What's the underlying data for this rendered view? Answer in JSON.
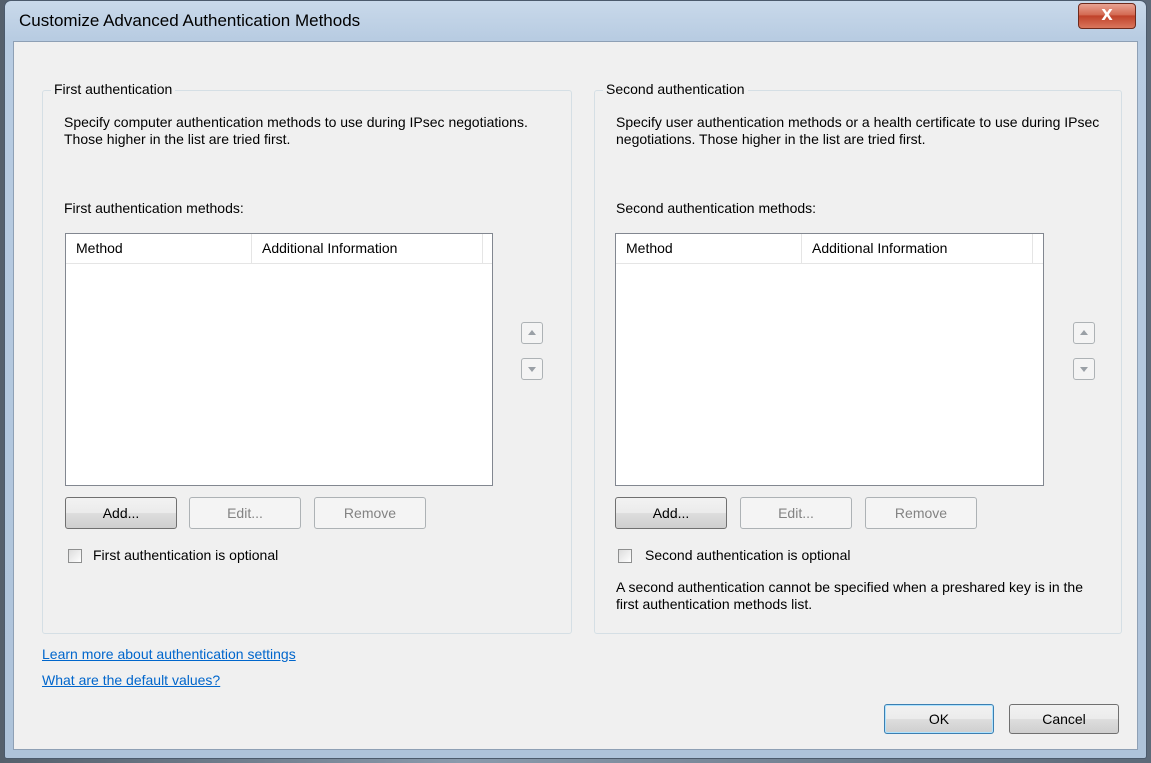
{
  "window": {
    "title": "Customize Advanced Authentication Methods",
    "close_label": "X"
  },
  "first": {
    "group_label": "First authentication",
    "description": "Specify computer authentication methods to use during IPsec negotiations.  Those higher in the list are tried first.",
    "list_label": "First authentication methods:",
    "columns": [
      "Method",
      "Additional Information"
    ],
    "add_label": "Add...",
    "edit_label": "Edit...",
    "remove_label": "Remove",
    "optional_label": "First authentication is optional",
    "optional_checked": false
  },
  "second": {
    "group_label": "Second authentication",
    "description": "Specify user authentication methods or a health certificate to use during IPsec negotiations.  Those higher in the list are tried first.",
    "list_label": "Second authentication methods:",
    "columns": [
      "Method",
      "Additional Information"
    ],
    "add_label": "Add...",
    "edit_label": "Edit...",
    "remove_label": "Remove",
    "optional_label": "Second authentication is optional",
    "optional_checked": false,
    "note": "A second authentication cannot be specified when a preshared key is in the first authentication methods list."
  },
  "links": {
    "learn_more": "Learn more about authentication settings",
    "defaults": "What are the default values?"
  },
  "buttons": {
    "ok": "OK",
    "cancel": "Cancel"
  },
  "icons": {
    "move_up": "up-arrow-icon",
    "move_down": "down-arrow-icon",
    "close": "close-icon"
  },
  "colors": {
    "link": "#0066cc",
    "close_button": "#c0422a",
    "dialog_bg": "#f0f0f0"
  }
}
